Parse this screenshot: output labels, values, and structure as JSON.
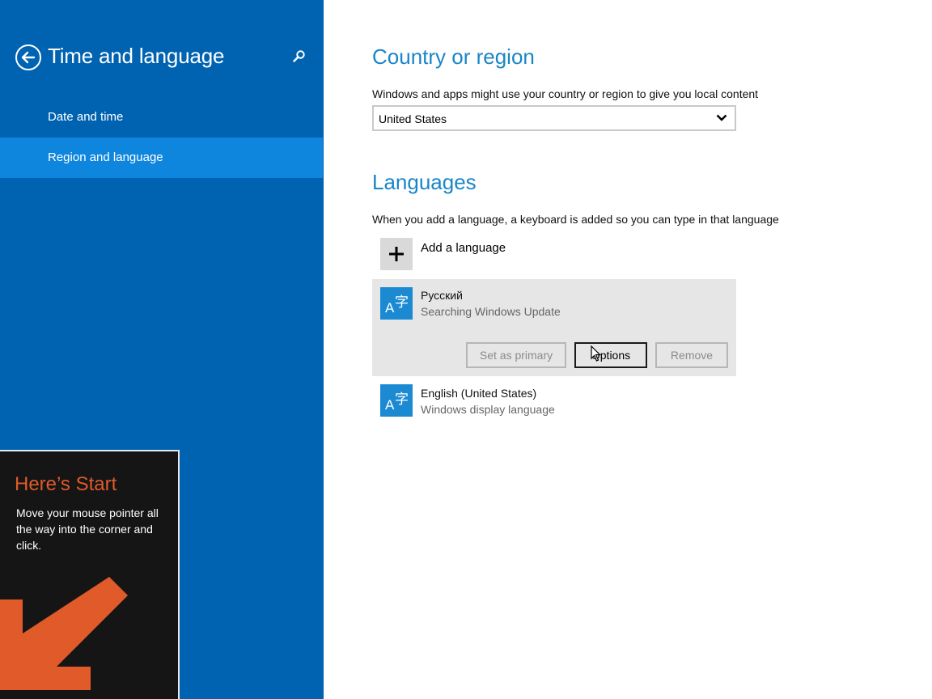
{
  "sidebar": {
    "title": "Time and language",
    "items": [
      {
        "label": "Date and time",
        "selected": false
      },
      {
        "label": "Region and language",
        "selected": true
      }
    ],
    "accent_color": "#0063b1",
    "selected_color": "#0f86de"
  },
  "start_tip": {
    "title": "Here’s Start",
    "body": "Move your mouse pointer all the way into the corner and click."
  },
  "country_region": {
    "title": "Country or region",
    "description": "Windows and apps might use your country or region to give you local content",
    "selected_value": "United States"
  },
  "languages": {
    "title": "Languages",
    "description": "When you add a language, a keyboard is added so you can type in that language",
    "add_label": "Add a language",
    "items": [
      {
        "name": "Русский",
        "status": "Searching Windows Update",
        "buttons": {
          "set_primary": "Set as primary",
          "options": "Options",
          "remove": "Remove"
        }
      },
      {
        "name": "English (United States)",
        "status": "Windows display language"
      }
    ],
    "icon_glyphs": {
      "latin": "A",
      "cjk": "字"
    }
  }
}
